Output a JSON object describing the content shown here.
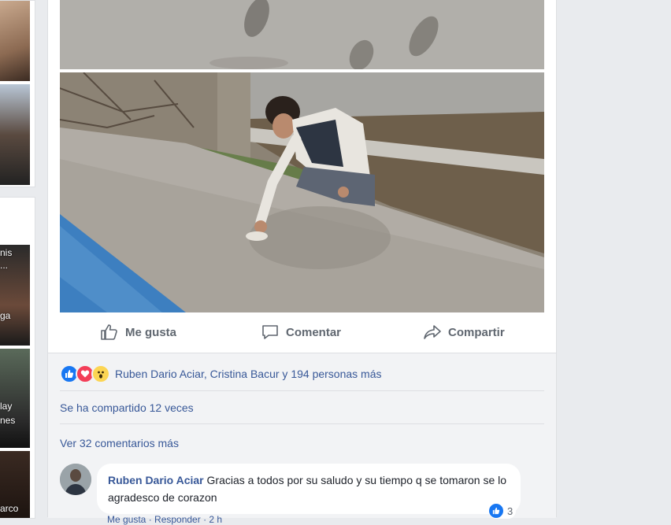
{
  "left_column": {
    "captions": [
      "nis",
      "...",
      "ga",
      "lay",
      "nes",
      "arco"
    ]
  },
  "post": {
    "actions": {
      "like_label": "Me gusta",
      "comment_label": "Comentar",
      "share_label": "Compartir"
    },
    "reactions": {
      "icons": [
        "like-icon",
        "love-icon",
        "wow-icon"
      ],
      "summary": "Ruben Dario Aciar, Cristina Bacur y 194 personas más"
    },
    "shares": "Se ha compartido 12 veces",
    "more_comments": "Ver 32 comentarios más",
    "comment": {
      "author": "Ruben Dario Aciar",
      "text": "Gracias a todos por su saludo y su tiempo q se tomaron se lo agradesco de corazon",
      "reaction_count": "3",
      "meta": "Me gusta · Responder · 2 h"
    }
  },
  "colors": {
    "link": "#385898",
    "like_blue": "#1877f2",
    "love_red": "#f33e58",
    "wow_yellow": "#fcd553",
    "page_bg": "#e9ebee",
    "feedback_bg": "#f2f3f5"
  }
}
